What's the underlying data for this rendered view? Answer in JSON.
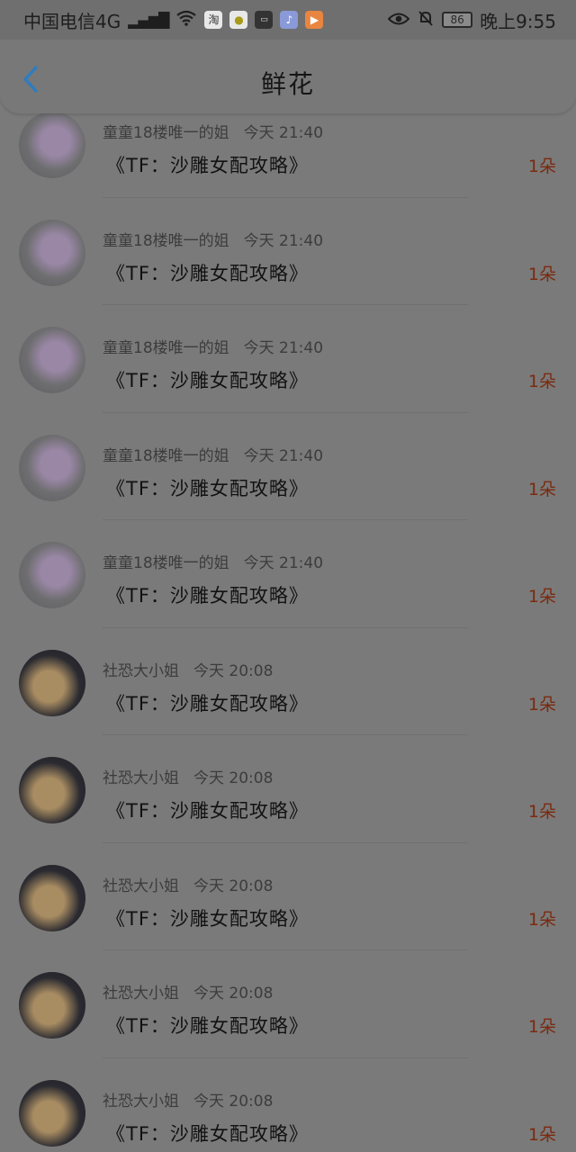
{
  "status_bar": {
    "carrier": "中国电信4G",
    "network_badge": "4G",
    "app_icons": [
      "taobao-icon",
      "lemon-icon",
      "video-app-icon",
      "music-icon",
      "media-play-icon"
    ],
    "battery": "86",
    "time": "晚上9:55"
  },
  "header": {
    "title": "鲜花",
    "back_icon": "chevron-left-icon",
    "accent_color": "#2f7cc0"
  },
  "list": [
    {
      "avatar": "avatar-girl",
      "user": "童童18楼唯一的姐",
      "time": "今天 21:40",
      "book": "《TF：沙雕女配攻略》",
      "count": "1朵"
    },
    {
      "avatar": "avatar-girl",
      "user": "童童18楼唯一的姐",
      "time": "今天 21:40",
      "book": "《TF：沙雕女配攻略》",
      "count": "1朵"
    },
    {
      "avatar": "avatar-girl",
      "user": "童童18楼唯一的姐",
      "time": "今天 21:40",
      "book": "《TF：沙雕女配攻略》",
      "count": "1朵"
    },
    {
      "avatar": "avatar-girl",
      "user": "童童18楼唯一的姐",
      "time": "今天 21:40",
      "book": "《TF：沙雕女配攻略》",
      "count": "1朵"
    },
    {
      "avatar": "avatar-girl",
      "user": "童童18楼唯一的姐",
      "time": "今天 21:40",
      "book": "《TF：沙雕女配攻略》",
      "count": "1朵"
    },
    {
      "avatar": "avatar-cat",
      "user": "社恐大小姐",
      "time": "今天 20:08",
      "book": "《TF：沙雕女配攻略》",
      "count": "1朵"
    },
    {
      "avatar": "avatar-cat",
      "user": "社恐大小姐",
      "time": "今天 20:08",
      "book": "《TF：沙雕女配攻略》",
      "count": "1朵"
    },
    {
      "avatar": "avatar-cat",
      "user": "社恐大小姐",
      "time": "今天 20:08",
      "book": "《TF：沙雕女配攻略》",
      "count": "1朵"
    },
    {
      "avatar": "avatar-cat",
      "user": "社恐大小姐",
      "time": "今天 20:08",
      "book": "《TF：沙雕女配攻略》",
      "count": "1朵"
    },
    {
      "avatar": "avatar-cat",
      "user": "社恐大小姐",
      "time": "今天 20:08",
      "book": "《TF：沙雕女配攻略》",
      "count": "1朵"
    }
  ]
}
